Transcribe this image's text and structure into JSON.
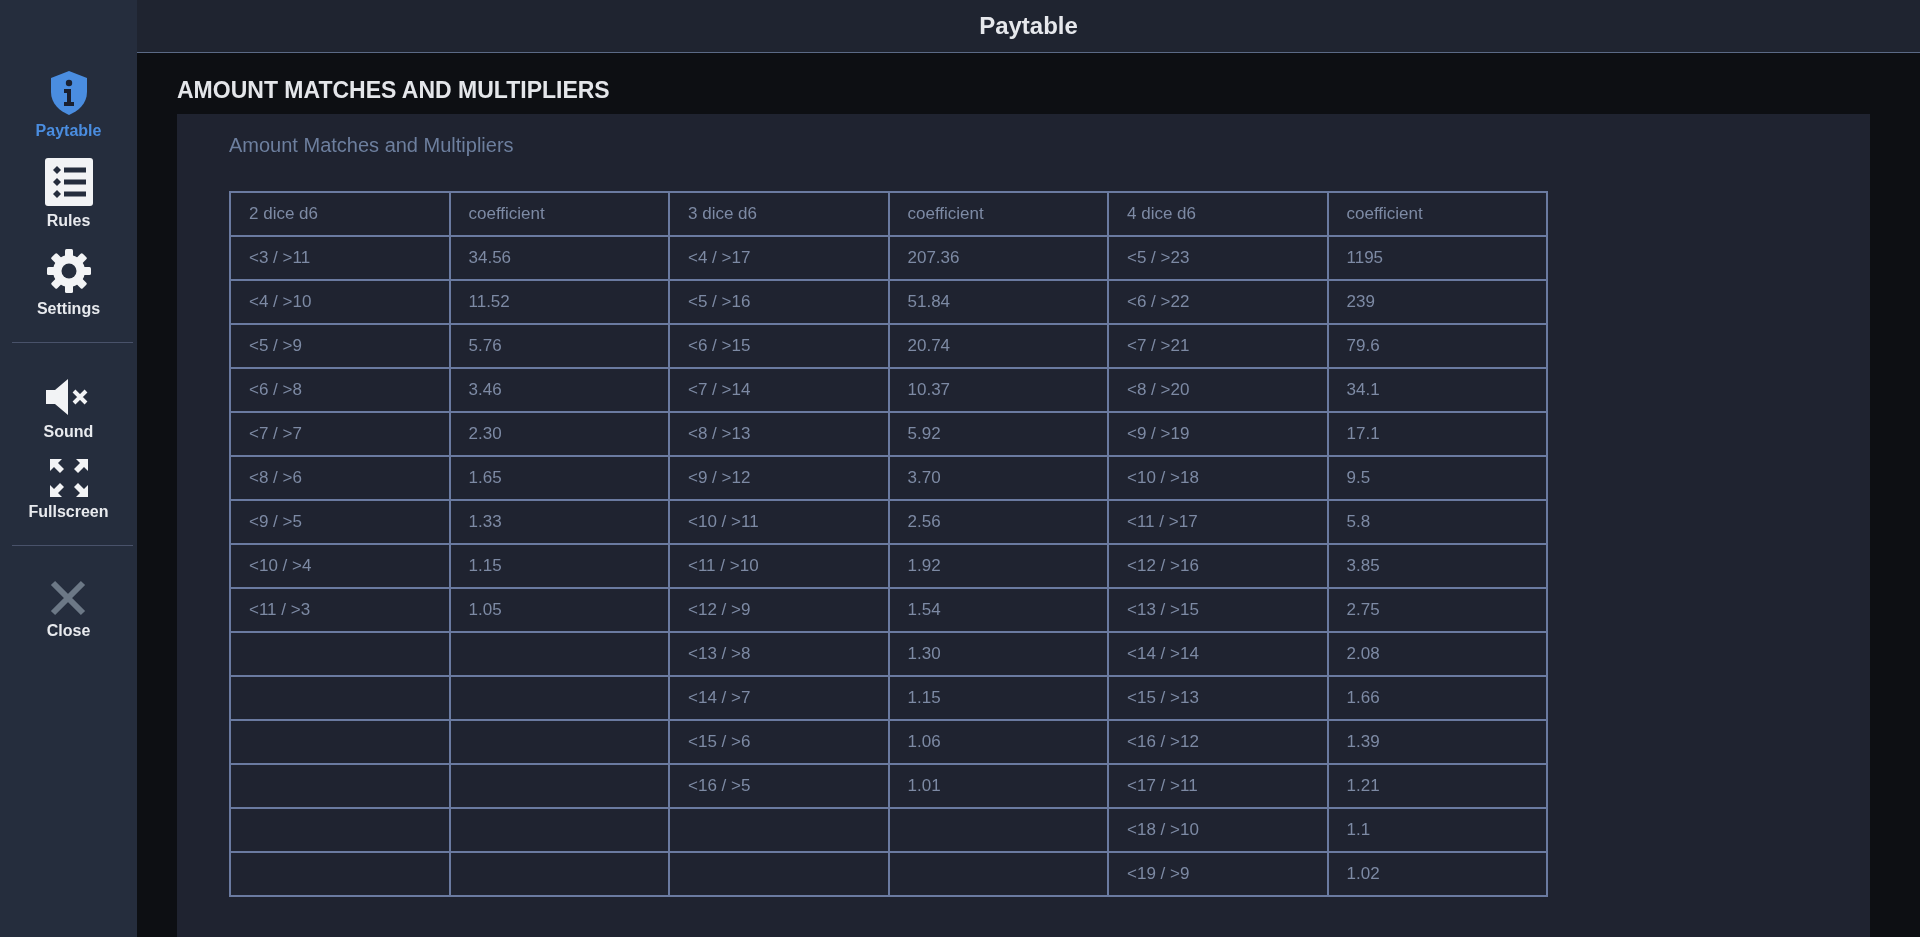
{
  "window": {
    "title": "Paytable"
  },
  "sidebar": {
    "sections": [
      [
        {
          "label": "Paytable",
          "kind": "info",
          "selected": true
        },
        {
          "label": "Rules",
          "kind": "list",
          "selected": false
        },
        {
          "label": "Settings",
          "kind": "gear",
          "selected": false
        }
      ],
      [
        {
          "label": "Sound",
          "kind": "sound-off",
          "selected": false
        },
        {
          "label": "Fullscreen",
          "kind": "fullscreen",
          "selected": false
        }
      ],
      [
        {
          "label": "Close",
          "kind": "close",
          "selected": false
        }
      ]
    ]
  },
  "page": {
    "heading": "AMOUNT MATCHES AND MULTIPLIERS",
    "subtitle": "Amount Matches and Multipliers"
  },
  "table": {
    "groups": [
      {
        "header": "2 dice d6",
        "coefficient_header": "coefficient",
        "rows": [
          {
            "range": "<3 / >11",
            "coefficient": "34.56"
          },
          {
            "range": "<4 / >10",
            "coefficient": "11.52"
          },
          {
            "range": "<5 / >9",
            "coefficient": "5.76"
          },
          {
            "range": "<6 / >8",
            "coefficient": "3.46"
          },
          {
            "range": "<7 / >7",
            "coefficient": "2.30"
          },
          {
            "range": "<8 / >6",
            "coefficient": "1.65"
          },
          {
            "range": "<9 / >5",
            "coefficient": "1.33"
          },
          {
            "range": "<10 / >4",
            "coefficient": "1.15"
          },
          {
            "range": "<11 / >3",
            "coefficient": "1.05"
          }
        ]
      },
      {
        "header": "3 dice d6",
        "coefficient_header": "coefficient",
        "rows": [
          {
            "range": "<4 / >17",
            "coefficient": "207.36"
          },
          {
            "range": "<5 / >16",
            "coefficient": "51.84"
          },
          {
            "range": "<6 / >15",
            "coefficient": "20.74"
          },
          {
            "range": "<7 / >14",
            "coefficient": "10.37"
          },
          {
            "range": "<8 / >13",
            "coefficient": "5.92"
          },
          {
            "range": "<9 / >12",
            "coefficient": "3.70"
          },
          {
            "range": "<10 / >11",
            "coefficient": "2.56"
          },
          {
            "range": "<11 / >10",
            "coefficient": "1.92"
          },
          {
            "range": "<12 / >9",
            "coefficient": "1.54"
          },
          {
            "range": "<13 / >8",
            "coefficient": "1.30"
          },
          {
            "range": "<14 / >7",
            "coefficient": "1.15"
          },
          {
            "range": "<15 / >6",
            "coefficient": "1.06"
          },
          {
            "range": "<16 / >5",
            "coefficient": "1.01"
          }
        ]
      },
      {
        "header": "4 dice d6",
        "coefficient_header": "coefficient",
        "rows": [
          {
            "range": "<5 / >23",
            "coefficient": "1195"
          },
          {
            "range": "<6 / >22",
            "coefficient": "239"
          },
          {
            "range": "<7 / >21",
            "coefficient": "79.6"
          },
          {
            "range": "<8 / >20",
            "coefficient": "34.1"
          },
          {
            "range": "<9 / >19",
            "coefficient": "17.1"
          },
          {
            "range": "<10 / >18",
            "coefficient": "9.5"
          },
          {
            "range": "<11 / >17",
            "coefficient": "5.8"
          },
          {
            "range": "<12 / >16",
            "coefficient": "3.85"
          },
          {
            "range": "<13 / >15",
            "coefficient": "2.75"
          },
          {
            "range": "<14 / >14",
            "coefficient": "2.08"
          },
          {
            "range": "<15 / >13",
            "coefficient": "1.66"
          },
          {
            "range": "<16 / >12",
            "coefficient": "1.39"
          },
          {
            "range": "<17 / >11",
            "coefficient": "1.21"
          },
          {
            "range": "<18 / >10",
            "coefficient": "1.1"
          },
          {
            "range": "<19 / >9",
            "coefficient": "1.02"
          }
        ]
      }
    ]
  }
}
